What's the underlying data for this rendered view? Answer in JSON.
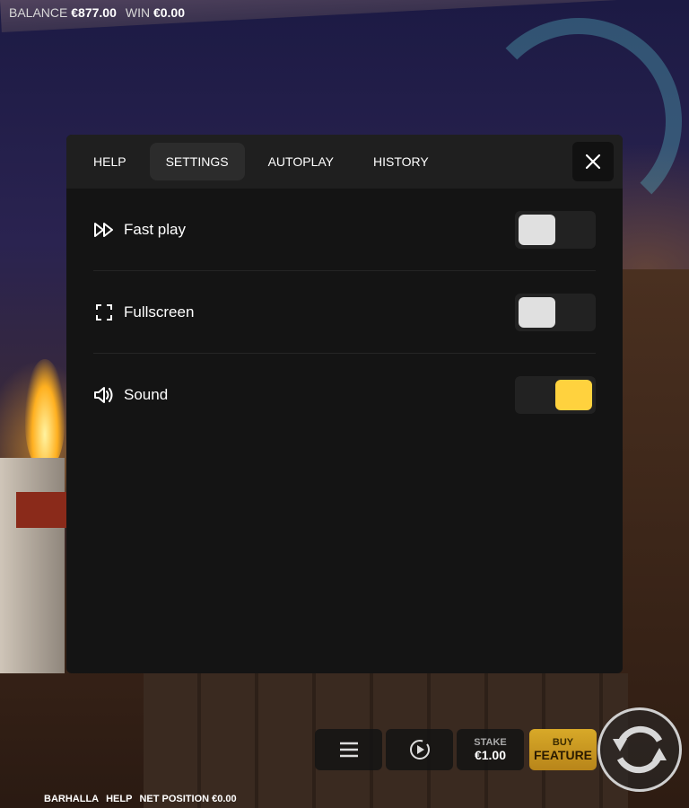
{
  "topbar": {
    "balance_label": "BALANCE",
    "balance_value": "€877.00",
    "win_label": "WIN",
    "win_value": "€0.00"
  },
  "tabs": [
    {
      "label": "HELP"
    },
    {
      "label": "SETTINGS",
      "active": true
    },
    {
      "label": "AUTOPLAY"
    },
    {
      "label": "HISTORY"
    }
  ],
  "settings": [
    {
      "label": "Fast play",
      "icon": "fast-forward-icon",
      "enabled": false
    },
    {
      "label": "Fullscreen",
      "icon": "fullscreen-icon",
      "enabled": false
    },
    {
      "label": "Sound",
      "icon": "speaker-icon",
      "enabled": true
    }
  ],
  "controls": {
    "stake_label": "STAKE",
    "stake_value": "€1.00",
    "buy_top": "BUY",
    "buy_bottom": "FEATURE"
  },
  "footer": {
    "game": "BARHALLA",
    "help": "HELP",
    "net_label": "NET POSITION",
    "net_value": "€0.00"
  },
  "colors": {
    "accent": "#ffd23e",
    "panel": "#141414",
    "tabbar": "#1f1f1f"
  }
}
